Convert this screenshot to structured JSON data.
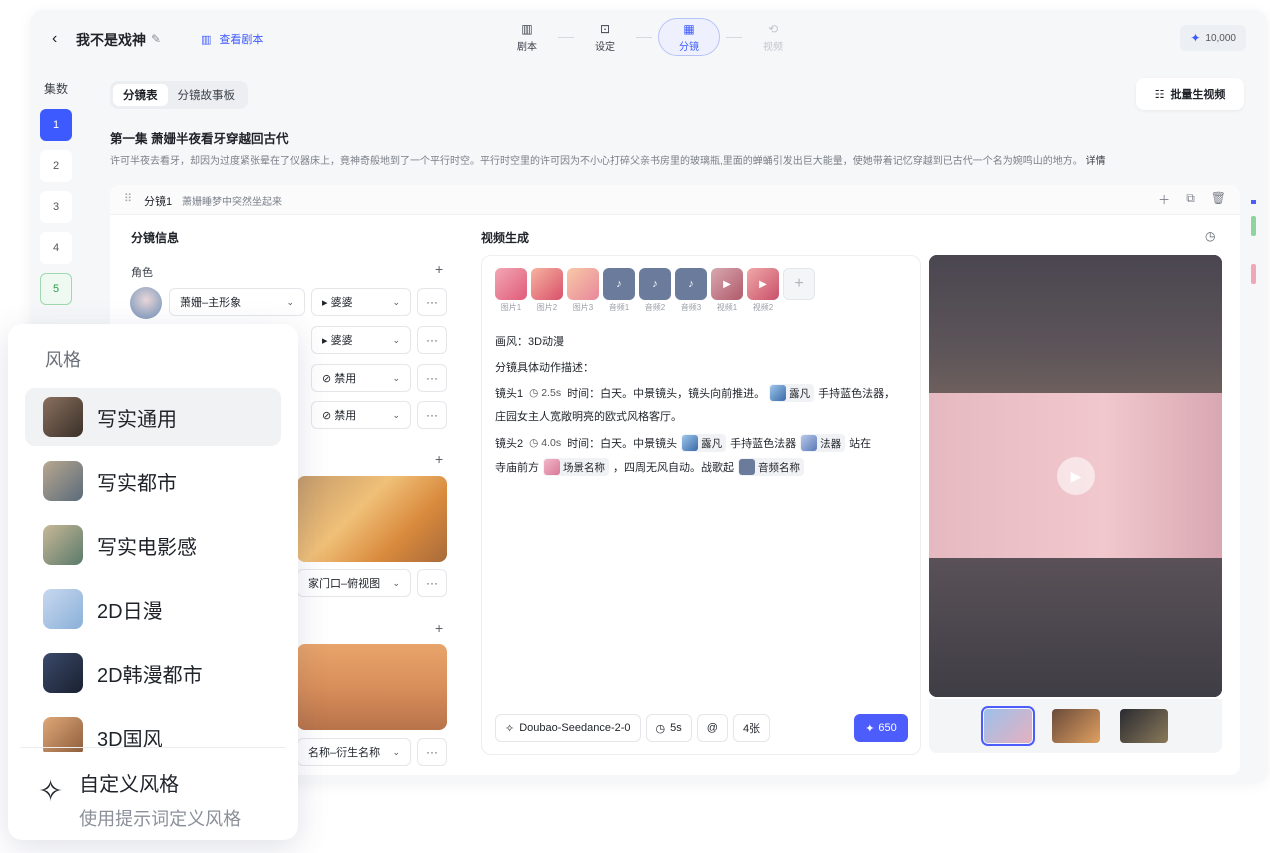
{
  "header": {
    "title": "我不是戏神",
    "script_link": "查看剧本",
    "credits": "10,000",
    "steps": [
      {
        "label": "剧本",
        "icon": "▥"
      },
      {
        "label": "设定",
        "icon": "⊡"
      },
      {
        "label": "分镜",
        "icon": "▦"
      },
      {
        "label": "视频",
        "icon": "⟲"
      }
    ]
  },
  "episodes": {
    "label": "集数",
    "items": [
      "1",
      "2",
      "3",
      "4",
      "5"
    ]
  },
  "subtabs": [
    "分镜表",
    "分镜故事板"
  ],
  "batch_button": "批量生视频",
  "episode": {
    "title": "第一集  萧姗半夜看牙穿越回古代",
    "desc": "许可半夜去看牙，却因为过度紧张晕在了仪器床上，竟神奇般地到了一个平行时空。平行时空里的许可因为不小心打碎父亲书房里的玻璃瓶,里面的蝉蛹引发出巨大能量，使她带着记忆穿越到已古代一个名为婉鸣山的地方。",
    "more": "详情"
  },
  "shot": {
    "no": "分镜1",
    "summary": "萧姗睡梦中突然坐起来"
  },
  "info": {
    "title": "分镜信息",
    "role_label": "角色",
    "roles": [
      {
        "name": "萧姗–主形象",
        "voice": "婆婆"
      },
      {
        "voice": "婆婆"
      },
      {
        "voice": "禁用"
      },
      {
        "voice": "禁用"
      }
    ],
    "scenes": [
      {
        "name": "家门口–俯视图"
      },
      {
        "name": "名称–衍生名称"
      }
    ]
  },
  "video_gen": {
    "title": "视频生成",
    "thumbs": [
      "图片1",
      "图片2",
      "图片3",
      "音频1",
      "音频2",
      "音频3",
      "视频1",
      "视频2"
    ],
    "style_line": "画风：3D动漫",
    "action_label": "分镜具体动作描述：",
    "shot1": {
      "label": "镜头1",
      "dur": "2.5s",
      "text1": "时间：白天。中景镜头，镜头向前推进。",
      "ref": "露凡",
      "text2": "手持蓝色法器，",
      "line2": "庄园女主人宽敞明亮的欧式风格客厅。"
    },
    "shot2": {
      "label": "镜头2",
      "dur": "4.0s",
      "text1": "时间：白天。中景镜头",
      "ref1": "露凡",
      "text2": "手持蓝色法器",
      "ref2": "法器",
      "text3": "站在",
      "line2a": "寺庙前方",
      "ref3": "场景名称",
      "line2b": "，四周无风自动。战歌起",
      "ref4": "音频名称"
    },
    "model": "Doubao-Seedance-2-0",
    "duration": "5s",
    "at": "@",
    "count": "4张",
    "cost": "650"
  },
  "style_panel": {
    "title": "风格",
    "items": [
      {
        "label": "写实通用",
        "color": "#6b5a4e"
      },
      {
        "label": "写实都市",
        "color": "#8a7a6b"
      },
      {
        "label": "写实电影感",
        "color": "#7b8a6b"
      },
      {
        "label": "2D日漫",
        "color": "#9cb3d6"
      },
      {
        "label": "2D韩漫都市",
        "color": "#2f3a55"
      },
      {
        "label": "3D国风",
        "color": "#c9946a"
      }
    ],
    "custom_title": "自定义风格",
    "custom_sub": "使用提示词定义风格"
  }
}
